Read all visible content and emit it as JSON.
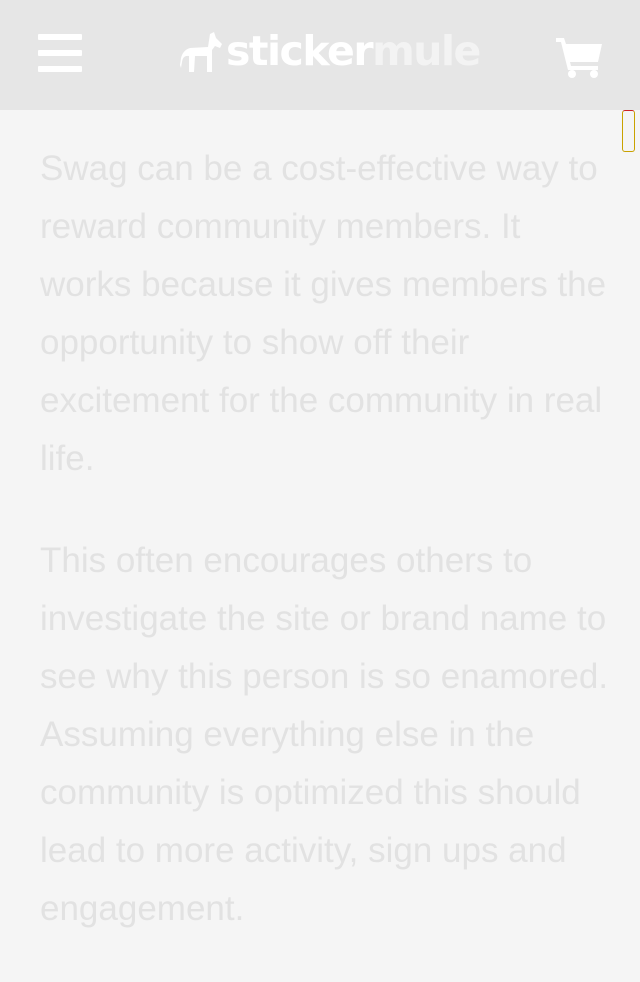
{
  "header": {
    "menu_icon": "hamburger-menu-icon",
    "logo": {
      "text_primary": "sticker",
      "text_secondary": "mule",
      "icon": "mule-logo-icon"
    },
    "cart_icon": "shopping-cart-icon"
  },
  "article": {
    "paragraphs": [
      "Swag can be a cost-effective way to reward community members. It works because it gives members the opportunity to show off their excitement for the community in real life.",
      "This often encourages others to investigate the site or brand name to see why this person is so enamored. Assuming everything else in the community is optimized this should lead to more activity, sign ups and engagement."
    ]
  },
  "colors": {
    "header_bg": "#e6e6e6",
    "page_bg": "#f5f5f5",
    "text": "#e2e2e2",
    "icon": "#ffffff"
  }
}
